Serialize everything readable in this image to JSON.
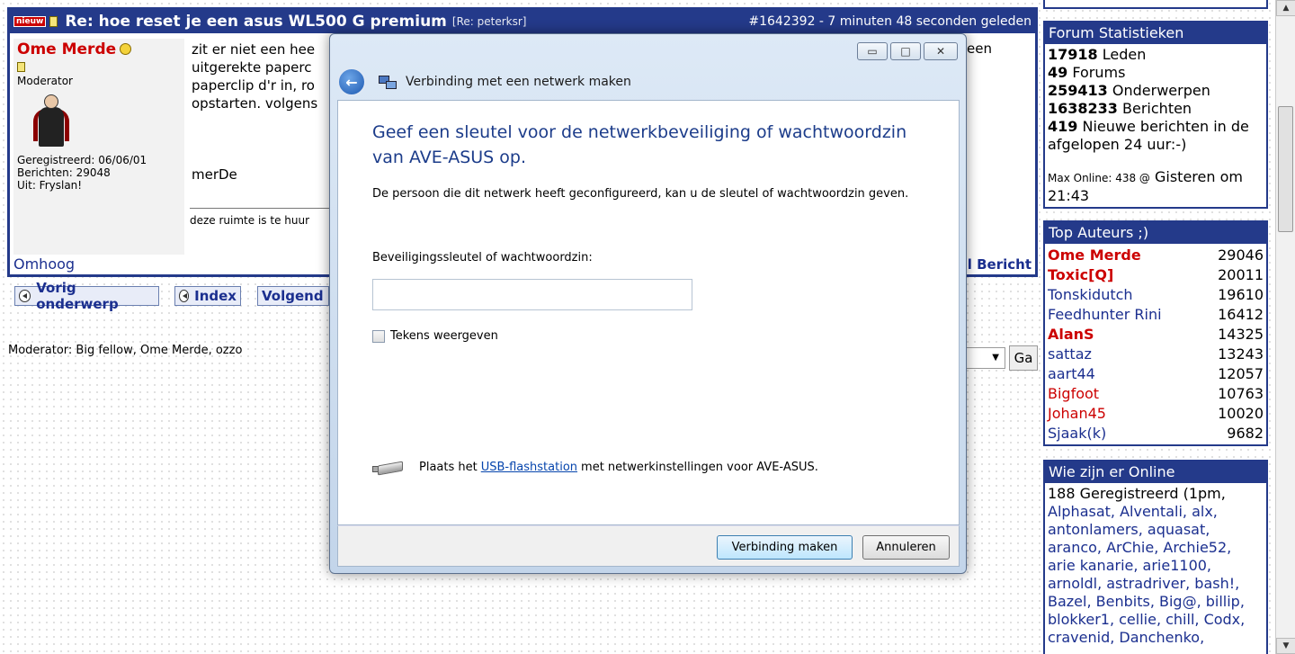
{
  "post": {
    "new_badge": "nieuw",
    "title": "Re: hoe reset je een asus WL500 G premium",
    "re_user": "[Re: peterksr]",
    "meta": "#1642392 - 7 minuten 48 seconden geleden",
    "author": {
      "name": "Ome Merde",
      "role": "Moderator",
      "registered": "Geregistreerd: 06/06/01",
      "posts": "Berichten: 29048",
      "location": "Uit: Fryslan!"
    },
    "body_lines": [
      "zit er niet een hee",
      "uitgerekte paperc",
      "paperclip d'r in, ro",
      "opstarten. volgens"
    ],
    "right_fragment": "een",
    "signature": "merDe",
    "footer_text": "deze ruimte is te huur",
    "up_link": "Omhoog",
    "pm_link": "il Bericht"
  },
  "nav": {
    "prev": "Vorig onderwerp",
    "index": "Index",
    "next": "Volgend o"
  },
  "moderators": "Moderator:  Big fellow, Ome Merde, ozzo",
  "go_button": "Ga",
  "stats": {
    "title": "Forum Statistieken",
    "rows": [
      {
        "num": "17918",
        "label": "Leden"
      },
      {
        "num": "49",
        "label": "Forums"
      },
      {
        "num": "259413",
        "label": "Onderwerpen"
      },
      {
        "num": "1638233",
        "label": "Berichten"
      },
      {
        "num": "419",
        "label": "Nieuwe berichten in de afgelopen 24 uur:-)"
      }
    ],
    "max_online_label": "Max Online: 438 @",
    "max_online_when": "Gisteren om 21:43"
  },
  "top_authors": {
    "title": "Top Auteurs ;)",
    "rows": [
      {
        "name": "Ome Merde",
        "count": "29046",
        "color": "#cc0000",
        "bold": true
      },
      {
        "name": "Toxic[Q]",
        "count": "20011",
        "color": "#cc0000",
        "bold": true
      },
      {
        "name": "Tonskidutch",
        "count": "19610",
        "color": "#1b2f8f",
        "bold": false
      },
      {
        "name": "Feedhunter Rini",
        "count": "16412",
        "color": "#1b2f8f",
        "bold": false
      },
      {
        "name": "AlanS",
        "count": "14325",
        "color": "#cc0000",
        "bold": true
      },
      {
        "name": "sattaz",
        "count": "13243",
        "color": "#1b2f8f",
        "bold": false
      },
      {
        "name": "aart44",
        "count": "12057",
        "color": "#1b2f8f",
        "bold": false
      },
      {
        "name": "Bigfoot",
        "count": "10763",
        "color": "#cc0000",
        "bold": false
      },
      {
        "name": "Johan45",
        "count": "10020",
        "color": "#cc0000",
        "bold": false
      },
      {
        "name": "Sjaak(k)",
        "count": "9682",
        "color": "#1b2f8f",
        "bold": false
      }
    ]
  },
  "online": {
    "title": "Wie zijn er Online",
    "lines": [
      "188 Geregistreerd (1pm,",
      "Alphasat, Alventali, alx,",
      "antonlamers, aquasat,",
      "aranco, ArChie, Archie52,",
      "arie kanarie, arie1100,",
      "arnoldl, astradriver, bash!,",
      "Bazel, Benbits, Big@, billip,",
      "blokker1, cellie, chill, Codx,",
      "cravenid, Danchenko,"
    ]
  },
  "dialog": {
    "title": "Verbinding met een netwerk maken",
    "heading": "Geef een sleutel voor de netwerkbeveiliging of wachtwoordzin van AVE-ASUS op.",
    "description": "De persoon die dit netwerk heeft geconfigureerd, kan u de sleutel of wachtwoordzin geven.",
    "key_label": "Beveiligingssleutel of wachtwoordzin:",
    "key_value": "",
    "show_chars": "Tekens weergeven",
    "usb_pre": "Plaats het",
    "usb_link": "USB-flashstation",
    "usb_post": "met netwerkinstellingen voor AVE-ASUS.",
    "connect_button": "Verbinding maken",
    "cancel_button": "Annuleren",
    "min_glyph": "▭",
    "max_glyph": "□",
    "close_glyph": "✕"
  }
}
